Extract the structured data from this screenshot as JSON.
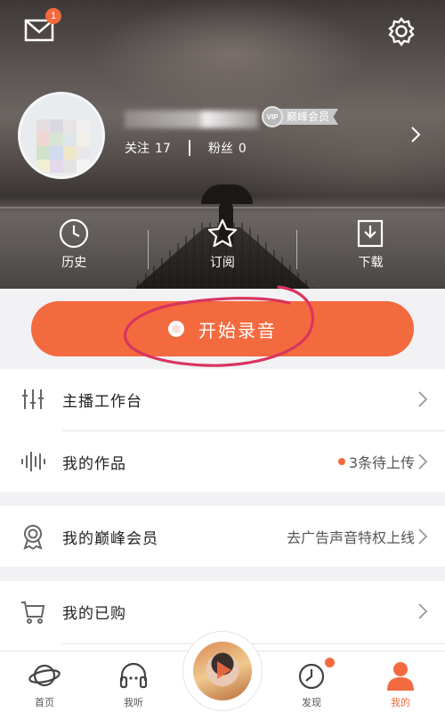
{
  "header": {
    "mail_badge_count": "1",
    "vip_medal": "VIP",
    "vip_label": "巅峰会员",
    "following_label": "关注",
    "following_count": "17",
    "fans_label": "粉丝",
    "fans_count": "0",
    "quick_actions": [
      {
        "label": "历史",
        "icon": "clock-icon"
      },
      {
        "label": "订阅",
        "icon": "star-icon"
      },
      {
        "label": "下载",
        "icon": "download-icon"
      }
    ]
  },
  "record": {
    "label": "开始录音"
  },
  "menu": {
    "studio": {
      "title": "主播工作台",
      "icon": "equalizer-icon"
    },
    "works": {
      "title": "我的作品",
      "icon": "waveform-icon",
      "status": "3条待上传"
    },
    "vip": {
      "title": "我的巅峰会员",
      "icon": "medal-icon",
      "status": "去广告声音特权上线"
    },
    "purchased": {
      "title": "我的已购",
      "icon": "cart-icon"
    }
  },
  "tabbar": {
    "tabs": [
      {
        "label": "首页",
        "icon": "planet-icon"
      },
      {
        "label": "我听",
        "icon": "headphones-icon"
      },
      {
        "label": "",
        "icon": "play-disc-icon"
      },
      {
        "label": "发现",
        "icon": "compass-icon"
      },
      {
        "label": "我的",
        "icon": "person-icon"
      }
    ],
    "active_color": "#f46a3f"
  },
  "colors": {
    "accent": "#f46a3f",
    "badge": "#f4693e"
  }
}
